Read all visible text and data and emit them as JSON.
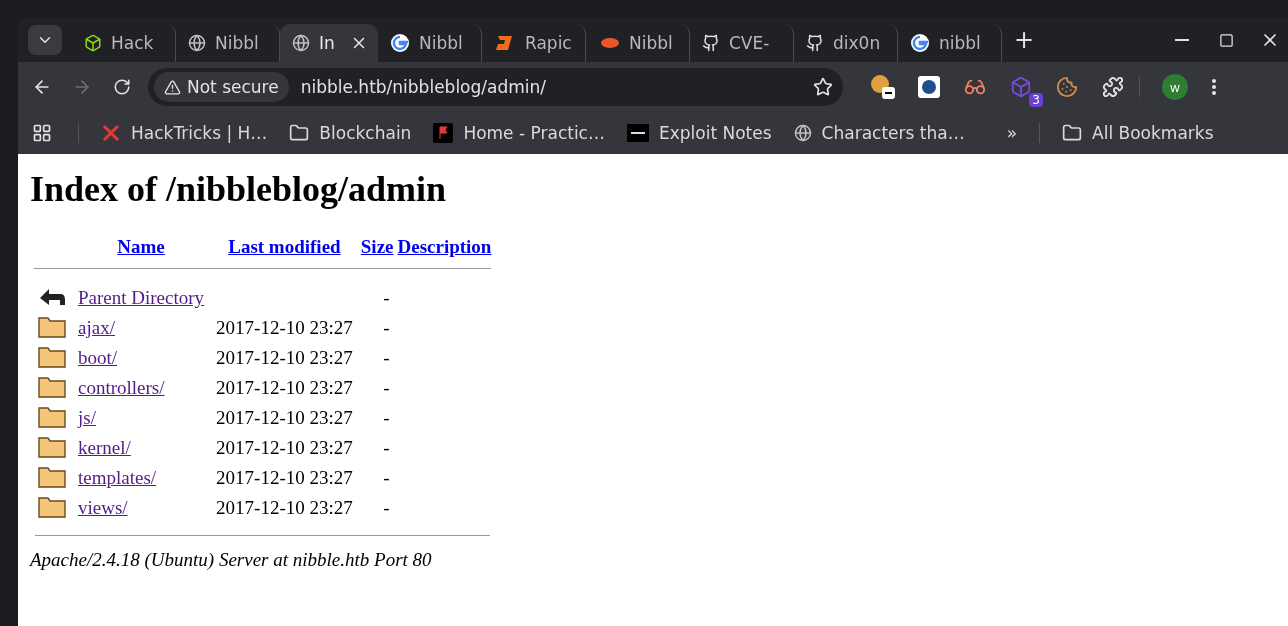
{
  "tabs": [
    {
      "title": "Hack",
      "selected": false
    },
    {
      "title": "Nibbl",
      "selected": false
    },
    {
      "title": "In",
      "selected": true
    },
    {
      "title": "Nibbl",
      "selected": false
    },
    {
      "title": "Rapic",
      "selected": false
    },
    {
      "title": "Nibbl",
      "selected": false
    },
    {
      "title": "CVE-",
      "selected": false
    },
    {
      "title": "dix0n",
      "selected": false
    },
    {
      "title": "nibbl",
      "selected": false
    }
  ],
  "new_tab": "+",
  "toolbar": {
    "security": "Not secure",
    "url": "nibble.htb/nibbleblog/admin/",
    "bookmarked": false,
    "extension_badge": "3",
    "profile": "w"
  },
  "bookmarks": {
    "items": [
      "HackTricks | H…",
      "Blockchain",
      "Home - Practic…",
      "Exploit Notes",
      "Characters tha…"
    ],
    "overflow": "»",
    "all": "All Bookmarks"
  },
  "page": {
    "heading": "Index of /nibbleblog/admin",
    "columns": [
      "Name",
      "Last modified",
      "Size",
      "Description"
    ],
    "rows": [
      {
        "kind": "parent",
        "name": "Parent Directory",
        "modified": "",
        "size": "-"
      },
      {
        "kind": "folder",
        "name": "ajax/",
        "modified": "2017-12-10 23:27",
        "size": "-"
      },
      {
        "kind": "folder",
        "name": "boot/",
        "modified": "2017-12-10 23:27",
        "size": "-"
      },
      {
        "kind": "folder",
        "name": "controllers/",
        "modified": "2017-12-10 23:27",
        "size": "-"
      },
      {
        "kind": "folder",
        "name": "js/",
        "modified": "2017-12-10 23:27",
        "size": "-"
      },
      {
        "kind": "folder",
        "name": "kernel/",
        "modified": "2017-12-10 23:27",
        "size": "-"
      },
      {
        "kind": "folder",
        "name": "templates/",
        "modified": "2017-12-10 23:27",
        "size": "-"
      },
      {
        "kind": "folder",
        "name": "views/",
        "modified": "2017-12-10 23:27",
        "size": "-"
      }
    ],
    "footer": "Apache/2.4.18 (Ubuntu) Server at nibble.htb Port 80"
  }
}
